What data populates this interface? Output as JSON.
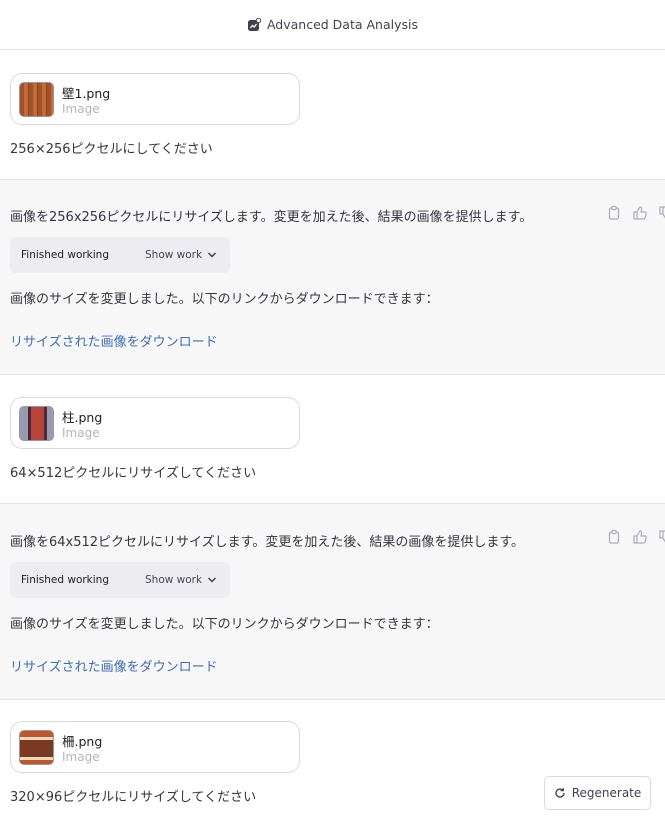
{
  "header": {
    "title": "Advanced Data Analysis"
  },
  "conversation": [
    {
      "role": "user",
      "file": {
        "name": "壁1.png",
        "type": "Image"
      },
      "text": "256×256ピクセルにしてください"
    },
    {
      "role": "assistant",
      "intro": "画像を256x256ピクセルにリサイズします。変更を加えた後、結果の画像を提供します。",
      "status": "Finished working",
      "show_work": "Show work",
      "result": "画像のサイズを変更しました。以下のリンクからダウンロードできます：",
      "link": "リサイズされた画像をダウンロード"
    },
    {
      "role": "user",
      "file": {
        "name": "柱.png",
        "type": "Image"
      },
      "text": "64×512ピクセルにリサイズしてください"
    },
    {
      "role": "assistant",
      "intro": "画像を64x512ピクセルにリサイズします。変更を加えた後、結果の画像を提供します。",
      "status": "Finished working",
      "show_work": "Show work",
      "result": "画像のサイズを変更しました。以下のリンクからダウンロードできます：",
      "link": "リサイズされた画像をダウンロード"
    },
    {
      "role": "user",
      "file": {
        "name": "柵.png",
        "type": "Image"
      },
      "text": "320×96ピクセルにリサイズしてください"
    }
  ],
  "regenerate_label": "Regenerate",
  "colors": {
    "link": "#3b6fb6",
    "assistant_bg": "#f7f7f8",
    "pill_bg": "#ececf1"
  }
}
